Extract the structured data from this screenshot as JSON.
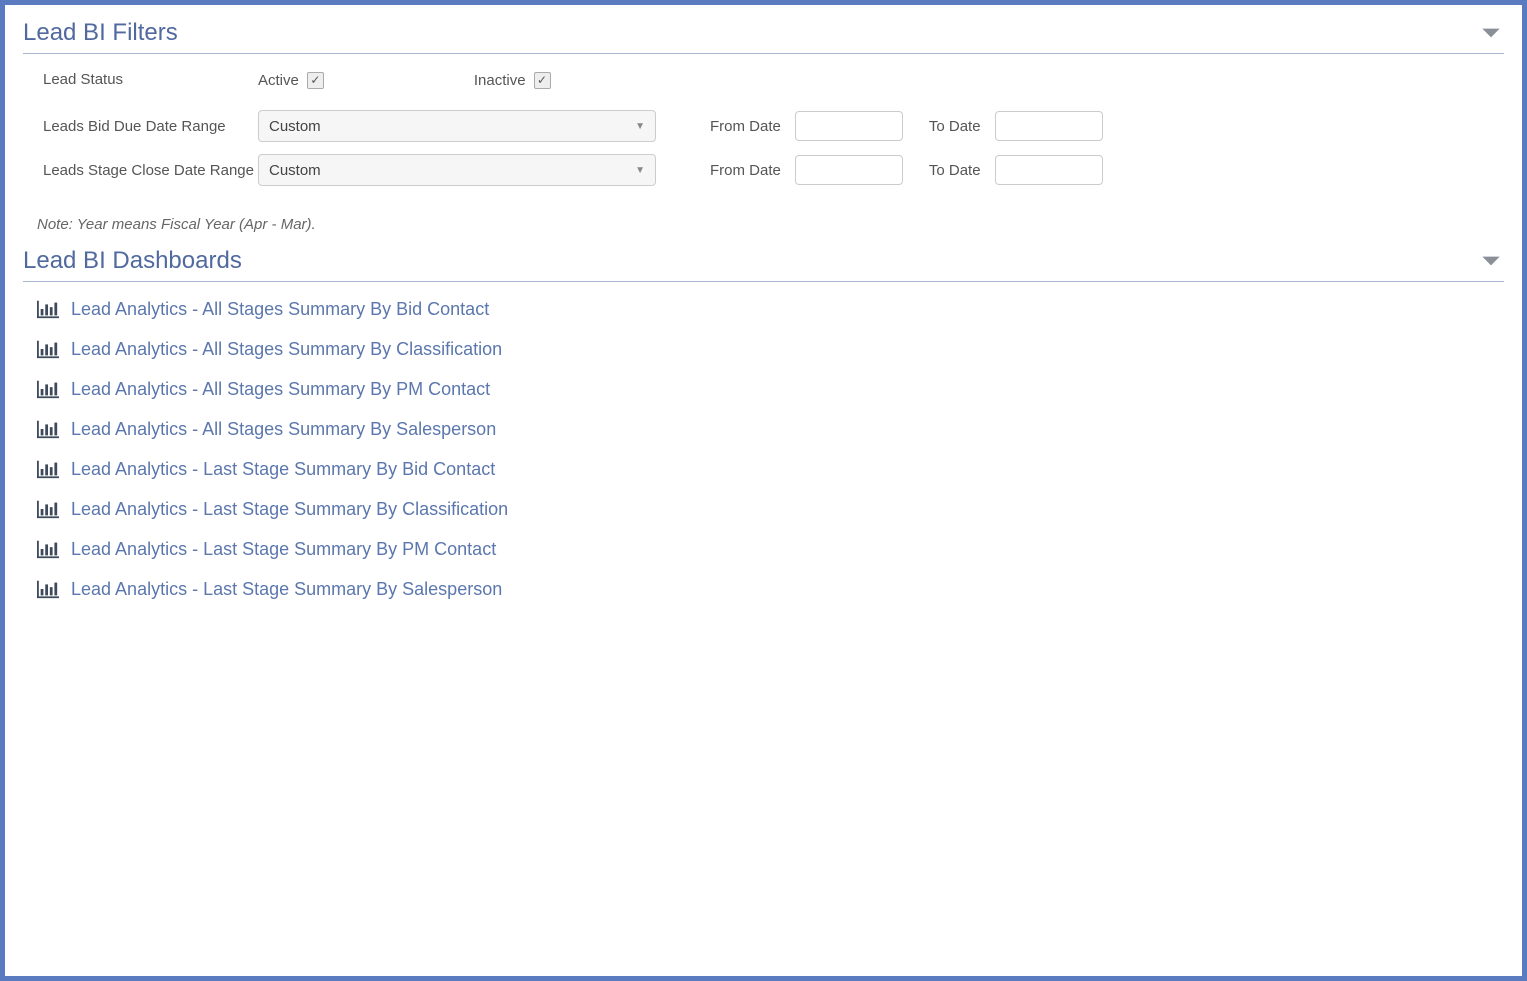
{
  "filters": {
    "title": "Lead BI Filters",
    "lead_status_label": "Lead Status",
    "active_label": "Active",
    "active_checked": true,
    "inactive_label": "Inactive",
    "inactive_checked": true,
    "bid_due_label": "Leads Bid Due Date Range",
    "bid_due_select": "Custom",
    "stage_close_label": "Leads Stage Close Date Range",
    "stage_close_select": "Custom",
    "from_date_label": "From Date",
    "to_date_label": "To Date",
    "bid_due_from": "",
    "bid_due_to": "",
    "stage_close_from": "",
    "stage_close_to": "",
    "note": "Note: Year means Fiscal Year (Apr - Mar)."
  },
  "dashboards": {
    "title": "Lead BI Dashboards",
    "items": [
      {
        "label": "Lead Analytics - All Stages Summary By Bid Contact"
      },
      {
        "label": "Lead Analytics - All Stages Summary By Classification"
      },
      {
        "label": "Lead Analytics - All Stages Summary By PM Contact"
      },
      {
        "label": "Lead Analytics - All Stages Summary By Salesperson"
      },
      {
        "label": "Lead Analytics - Last Stage Summary By Bid Contact"
      },
      {
        "label": "Lead Analytics - Last Stage Summary By Classification"
      },
      {
        "label": "Lead Analytics - Last Stage Summary By PM Contact"
      },
      {
        "label": "Lead Analytics - Last Stage Summary By Salesperson"
      }
    ]
  }
}
